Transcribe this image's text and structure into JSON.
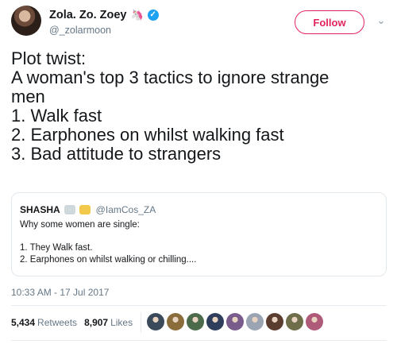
{
  "user": {
    "display_name": "Zola. Zo. Zoey",
    "name_emoji": "unicorn-icon",
    "verified": true,
    "handle": "@_zolarmoon"
  },
  "follow_label": "Follow",
  "tweet_lines": [
    "Plot twist:",
    "A woman's top 3 tactics to ignore strange",
    "men",
    "1. Walk fast",
    "2. Earphones on whilst walking fast",
    "3. Bad attitude to strangers"
  ],
  "quote": {
    "name": "SHASHA",
    "handle": "@IamCos_ZA",
    "lines": [
      "Why some women are single:",
      "1. They Walk fast.",
      "2. Earphones on whilst walking or chilling...."
    ]
  },
  "timestamp": "10:33 AM - 17 Jul 2017",
  "stats": {
    "retweets_count": "5,434",
    "retweets_label": "Retweets",
    "likes_count": "8,907",
    "likes_label": "Likes"
  },
  "colors": {
    "accent": "#e0245e",
    "verified": "#1da1f2",
    "muted": "#657786",
    "liker_avatars": [
      "#3b4a5a",
      "#8a6d3b",
      "#4b6b4b",
      "#2f3e5c",
      "#7a5c8c",
      "#9aa4b2",
      "#5a3d2e",
      "#6e6e4a",
      "#b05a7a"
    ]
  }
}
